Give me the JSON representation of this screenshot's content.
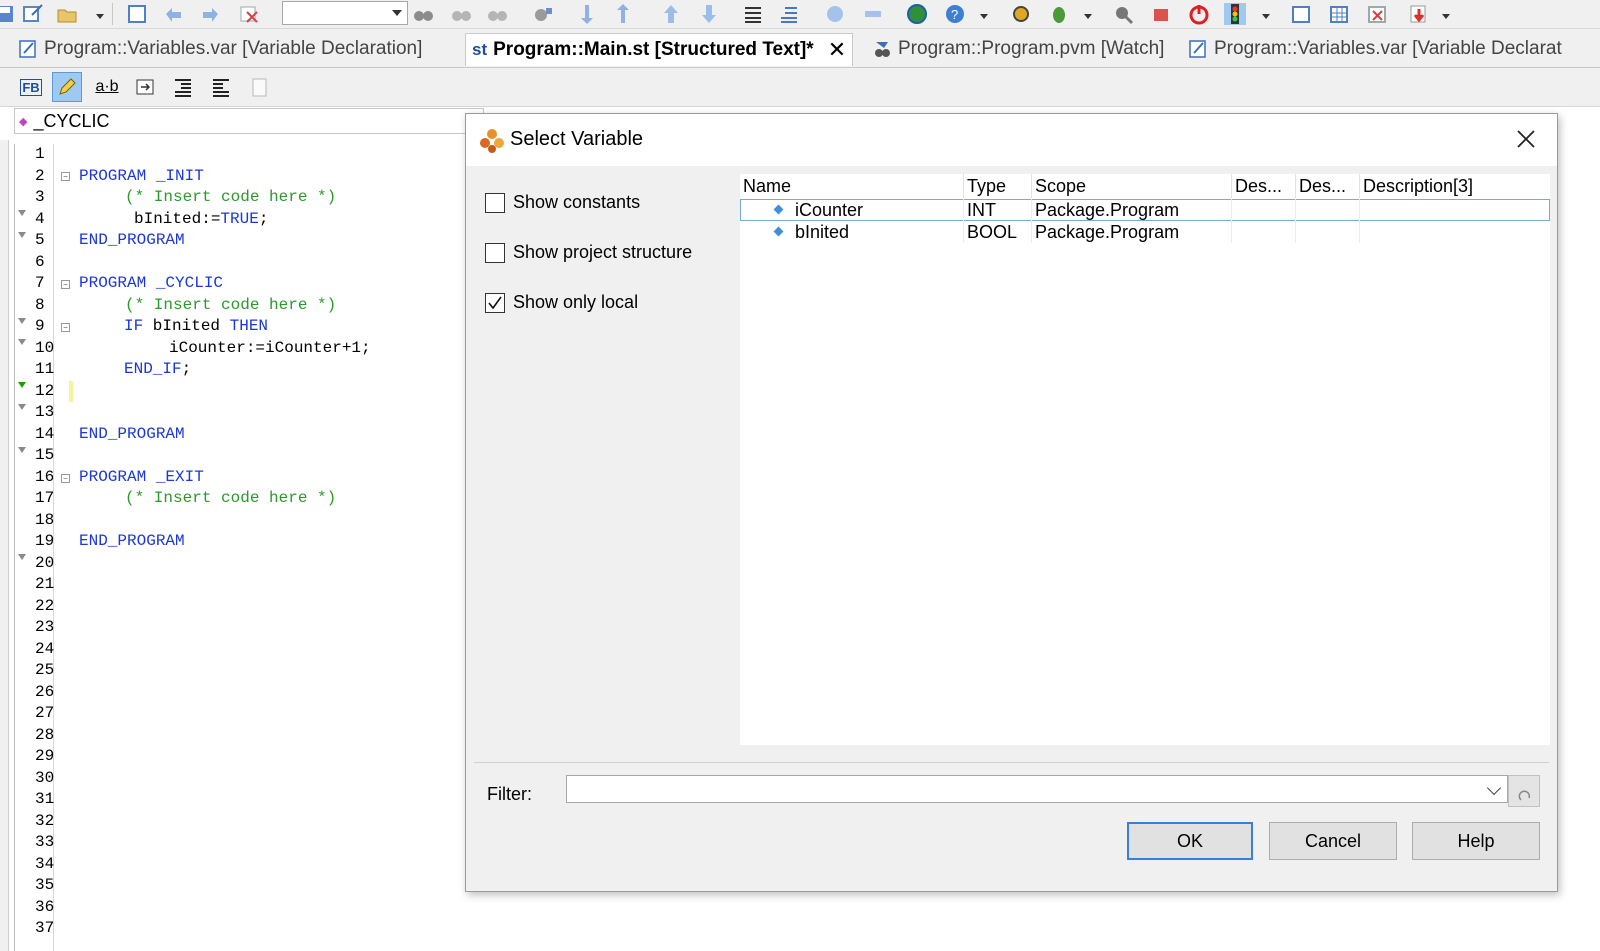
{
  "tabs": [
    {
      "label": "Program::Variables.var [Variable Declaration]",
      "active": false
    },
    {
      "label": "Program::Main.st [Structured Text]*",
      "active": true
    },
    {
      "label": "Program::Program.pvm [Watch]",
      "active": false
    },
    {
      "label": "Program::Variables.var [Variable Declarat",
      "active": false
    }
  ],
  "active_tab_icon": "st",
  "editor_toolbar": {
    "fb_icon": "FB",
    "ab_icon": "a·b"
  },
  "path": "_CYCLIC",
  "editor": {
    "line_numbers": [
      "1",
      "2",
      "3",
      "4",
      "5",
      "6",
      "7",
      "8",
      "9",
      "10",
      "11",
      "12",
      "13",
      "14",
      "15",
      "16",
      "17",
      "18",
      "19",
      "20",
      "21",
      "22",
      "23",
      "24",
      "25",
      "26",
      "27",
      "28",
      "29",
      "30",
      "31",
      "32",
      "33",
      "34",
      "35",
      "36",
      "37"
    ],
    "code": {
      "l2": "PROGRAM _INIT",
      "l3": "(* Insert code here *)",
      "l4a": "bInited:=",
      "l4b": "TRUE",
      "l4c": ";",
      "l5": "END_PROGRAM",
      "l7": "PROGRAM _CYCLIC",
      "l8": "(* Insert code here *)",
      "l9a": "IF",
      "l9b": " bInited ",
      "l9c": "THEN",
      "l10": "iCounter:=iCounter+1;",
      "l11a": "END_IF",
      "l11b": ";",
      "l14": "END_PROGRAM",
      "l16": "PROGRAM _EXIT",
      "l17": "(* Insert code here *)",
      "l19": "END_PROGRAM"
    }
  },
  "dialog": {
    "title": "Select Variable",
    "options": [
      {
        "label": "Show constants",
        "checked": false
      },
      {
        "label": "Show project structure",
        "checked": false
      },
      {
        "label": "Show only local",
        "checked": true
      }
    ],
    "columns": [
      "Name",
      "Type",
      "Scope",
      "Des...",
      "Des...",
      "Description[3]"
    ],
    "rows": [
      {
        "name": "iCounter",
        "type": "INT",
        "scope": "Package.Program",
        "selected": true
      },
      {
        "name": "bInited",
        "type": "BOOL",
        "scope": "Package.Program",
        "selected": false
      }
    ],
    "filter_label": "Filter:",
    "filter_value": "",
    "buttons": {
      "ok": "OK",
      "cancel": "Cancel",
      "help": "Help"
    }
  },
  "colors": {
    "keyword": "#1c37d8",
    "comment": "#2a9a2a",
    "selection": "#7aa7dc",
    "default_button_border": "#3b7ed8"
  }
}
